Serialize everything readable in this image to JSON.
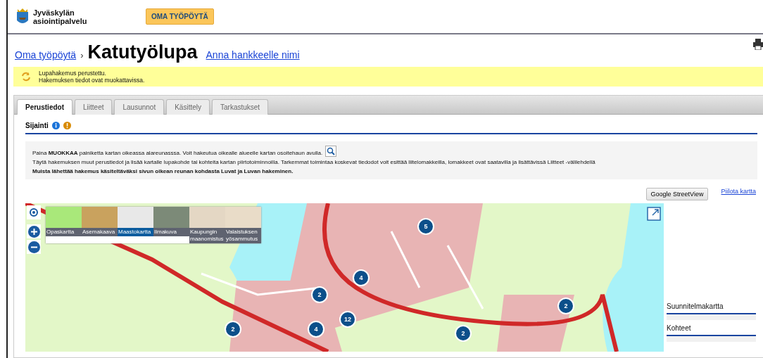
{
  "header": {
    "logo_lines": [
      "Jyväskylän",
      "asiointipalvelu"
    ],
    "nav_button": "OMA TYÖPÖYTÄ"
  },
  "breadcrumb": {
    "link": "Oma työpöytä",
    "separator": "›",
    "title": "Katutyölupa",
    "name_link": "Anna hankkeelle nimi"
  },
  "notice": {
    "lines": [
      "Lupahakemus perustettu.",
      "Hakemuksen tiedot ovat muokattavissa."
    ]
  },
  "tabs": [
    {
      "label": "Perustiedot",
      "selected": true
    },
    {
      "label": "Liitteet",
      "selected": false
    },
    {
      "label": "Lausunnot",
      "selected": false
    },
    {
      "label": "Käsittely",
      "selected": false
    },
    {
      "label": "Tarkastukset",
      "selected": false
    }
  ],
  "section": {
    "title": "Sijainti"
  },
  "instructions": [
    {
      "kind": "search",
      "text": "Paina **MUOKKAA** painiketta kartan oikeassa alareunasssa. Voit hakeutua oikealle alueelle kartan osoitehaun avulla."
    },
    {
      "kind": "plain",
      "text": "Täytä hakemuksen muut perustiedot ja lisää kartalle lupakohde tai kohteita kartan piirtotoiminnoilla. Tarkemmat toimintaa koskevat tiedodot voit esittää liitelomakkeilla, lomakkeet ovat saatavilla ja lisättävissä Liitteet -välilehdellä"
    },
    {
      "kind": "emphasis",
      "text": "Muista lähettää hakemus käsiteltäväksi sivun oikean reunan kohdasta **Luvat ja Luvan hakeminen.**"
    }
  ],
  "map_actions": {
    "streetview_button": "Google StreetView",
    "hide_link": "Piilota kartta"
  },
  "map": {
    "layers": [
      {
        "label": "Opaskartta",
        "selected": false
      },
      {
        "label": "Asemakaava",
        "selected": false
      },
      {
        "label": "Maastokartta",
        "selected": true
      },
      {
        "label": "Ilmakuva",
        "selected": false
      },
      {
        "label": "Kaupungin maanomistus",
        "selected": false
      },
      {
        "label": "Valaistuksen yösammutus",
        "selected": false
      }
    ],
    "clusters": [
      {
        "count": "5"
      },
      {
        "count": "4"
      },
      {
        "count": "2"
      },
      {
        "count": "12"
      },
      {
        "count": "4"
      },
      {
        "count": "2"
      },
      {
        "count": "2"
      },
      {
        "count": "2"
      }
    ]
  },
  "side_panels": [
    {
      "title": "Suunnitelmakartta"
    },
    {
      "title": "Kohteet"
    }
  ]
}
